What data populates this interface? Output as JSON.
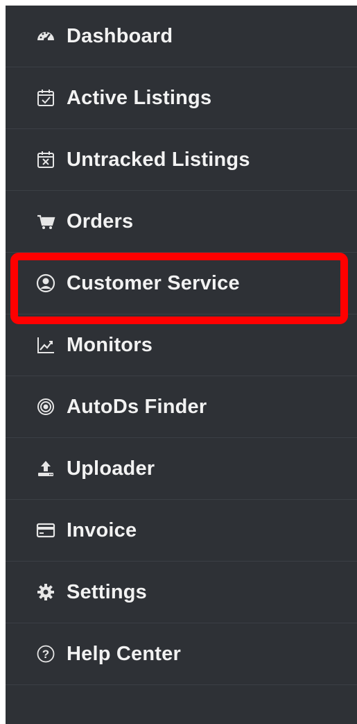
{
  "sidebar": {
    "background": "#2e3136",
    "items": [
      {
        "label": "Dashboard",
        "icon": "dashboard-gauge-icon"
      },
      {
        "label": "Active Listings",
        "icon": "calendar-check-icon"
      },
      {
        "label": "Untracked Listings",
        "icon": "calendar-x-icon"
      },
      {
        "label": "Orders",
        "icon": "shopping-cart-icon"
      },
      {
        "label": "Customer Service",
        "icon": "user-circle-icon"
      },
      {
        "label": "Monitors",
        "icon": "line-chart-icon"
      },
      {
        "label": "AutoDs Finder",
        "icon": "target-icon"
      },
      {
        "label": "Uploader",
        "icon": "upload-icon"
      },
      {
        "label": "Invoice",
        "icon": "credit-card-icon"
      },
      {
        "label": "Settings",
        "icon": "gear-icon"
      },
      {
        "label": "Help Center",
        "icon": "question-circle-icon"
      }
    ]
  },
  "highlight": {
    "target": "Customer Service",
    "color": "#ff0000"
  }
}
